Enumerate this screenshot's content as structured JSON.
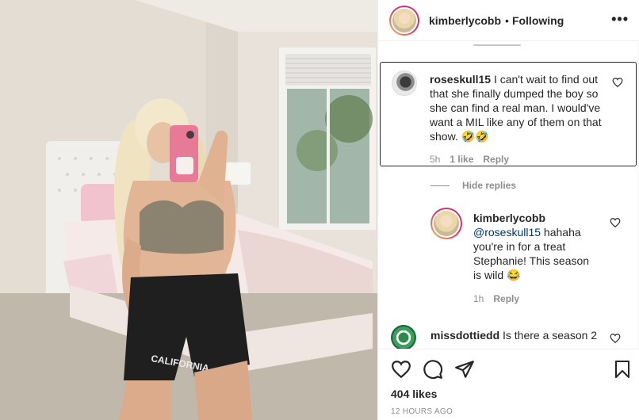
{
  "post": {
    "author": "kimberlycobb",
    "separator": "•",
    "follow_status": "Following",
    "more_label": "•••",
    "likes": "404 likes",
    "timestamp": "12 HOURS AGO",
    "shorts_text": "CALIFORNIA"
  },
  "comments": [
    {
      "username": "roseskull15",
      "text": "I can't wait to find out that she finally dumped the boy so she can find a real man. I would've want a MIL like any of them on that show. 🤣🤣",
      "time": "5h",
      "likes": "1 like",
      "reply": "Reply",
      "replies_toggle": "Hide replies",
      "replies": [
        {
          "username": "kimberlycobb",
          "mention": "@roseskull15",
          "text": "hahaha you're in for a treat Stephanie! This season is wild 😂",
          "time": "1h",
          "reply": "Reply"
        }
      ]
    },
    {
      "username": "missdottiedd",
      "text": "Is there a season 2"
    }
  ],
  "colors": {
    "text": "#262626",
    "muted": "#8e8e8e",
    "mention": "#00376b",
    "border": "#efefef"
  },
  "icons": [
    "heart-icon",
    "comment-icon",
    "share-icon",
    "bookmark-icon",
    "more-icon"
  ]
}
